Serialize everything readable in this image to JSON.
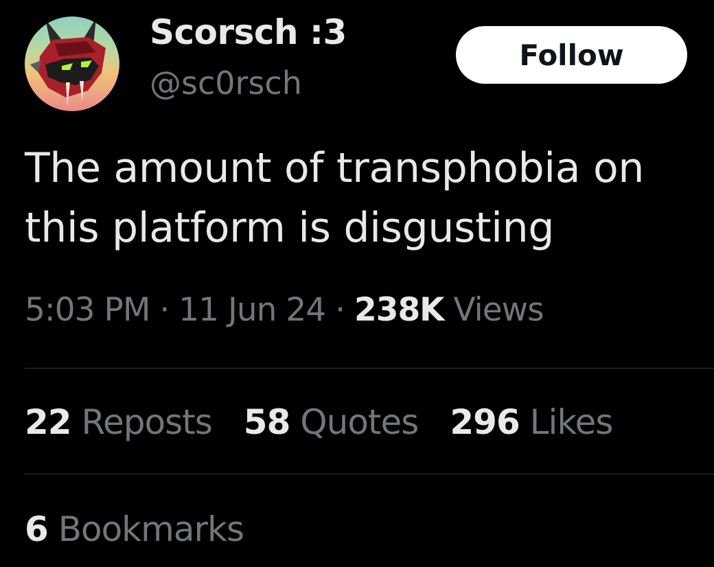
{
  "author": {
    "display_name": "Scorsch :3",
    "handle": "@sc0rsch",
    "avatar_icon": "demon-mask-avatar-icon"
  },
  "follow_button": {
    "label": "Follow"
  },
  "tweet": {
    "text": "The amount of transphobia on this platform is disgusting"
  },
  "meta": {
    "time": "5:03 PM",
    "separator": "·",
    "date": "11 Jun 24",
    "views_count": "238K",
    "views_label": "Views"
  },
  "stats": {
    "reposts": {
      "count": "22",
      "label": "Reposts"
    },
    "quotes": {
      "count": "58",
      "label": "Quotes"
    },
    "likes": {
      "count": "296",
      "label": "Likes"
    },
    "bookmarks": {
      "count": "6",
      "label": "Bookmarks"
    }
  },
  "colors": {
    "background": "#000000",
    "primary_text": "#e7e9ea",
    "secondary_text": "#71767b",
    "divider": "#2f3336",
    "button_bg": "#ffffff"
  }
}
